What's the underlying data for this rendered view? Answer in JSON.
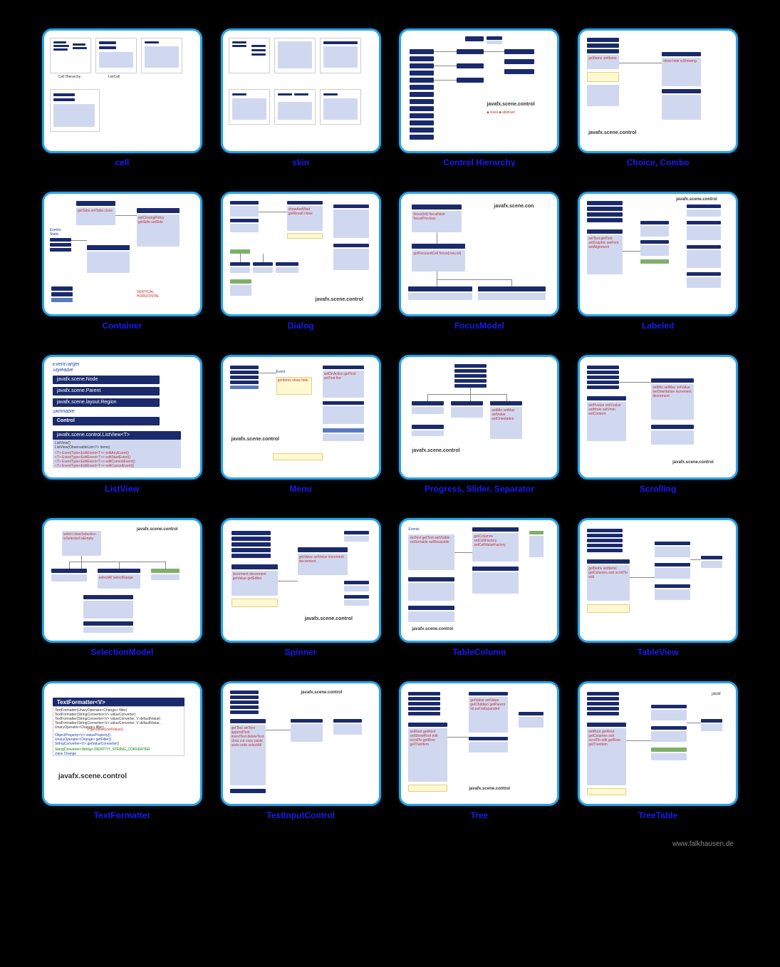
{
  "footer": "www.falkhausen.de",
  "cards": [
    {
      "label": "cell"
    },
    {
      "label": "skin"
    },
    {
      "label": "Control Hierarchy"
    },
    {
      "label": "Choice, Combo"
    },
    {
      "label": "Container"
    },
    {
      "label": "Dialog"
    },
    {
      "label": "FocusModel"
    },
    {
      "label": "Labeled"
    },
    {
      "label": "ListView"
    },
    {
      "label": "Menu"
    },
    {
      "label": "Progress, Slider, Separator"
    },
    {
      "label": "Scrolling"
    },
    {
      "label": "SelectionModel"
    },
    {
      "label": "Spinner"
    },
    {
      "label": "TableColumn"
    },
    {
      "label": "TableView"
    },
    {
      "label": "TextFormatter"
    },
    {
      "label": "TextInputControl"
    },
    {
      "label": "Tree"
    },
    {
      "label": "TreeTable"
    }
  ],
  "detail": {
    "listview": {
      "header1": "EventTarget",
      "header2": "Styleable",
      "box1": "javafx.scene.Node",
      "box2": "javafx.scene.Parent",
      "box3": "javafx.scene.layout.Region",
      "interface": "Skinnable",
      "box4": "Control",
      "box5": "javafx.scene.control.ListView<T>",
      "sub1": "ListView()",
      "sub2": "ListView(ObservableList<T> items)",
      "m1": "<T> EventType<EditEvent<T>> editAnyEvent()",
      "m2": "<T> EventType<EditEvent<T>> editStartEvent()",
      "m3": "<T> EventType<EditEvent<T>> editCommitEvent()",
      "m4": "<T> EventType<EditEvent<T>> editCancelEvent()"
    },
    "textformatter": {
      "title": "TextFormatter<V>",
      "c1": "TextFormatter(UnaryOperator<Change> filter)",
      "c2": "TextFormatter(StringConverter<V> valueConverter)",
      "c3": "TextFormatter(StringConverter<V> valueConverter, V defaultValue)",
      "c4": "TextFormatter(StringConverter<V> valueConverter, V defaultValue, UnaryOperator<Change> filter)",
      "m1": "V getValue()/setValue()",
      "m2": "ObjectProperty<V> valueProperty()",
      "m3": "UnaryOperator<Change> getFilter()",
      "m4": "StringConverter<V> getValueConverter()",
      "m5": "StringConverter<String> IDENTITY_STRING_CONVERTER",
      "m6": "class Change",
      "pkg": "javafx.scene.control"
    },
    "pkg_control": "javafx.scene.control",
    "pkg_javafx": "javafx.scene.con"
  }
}
